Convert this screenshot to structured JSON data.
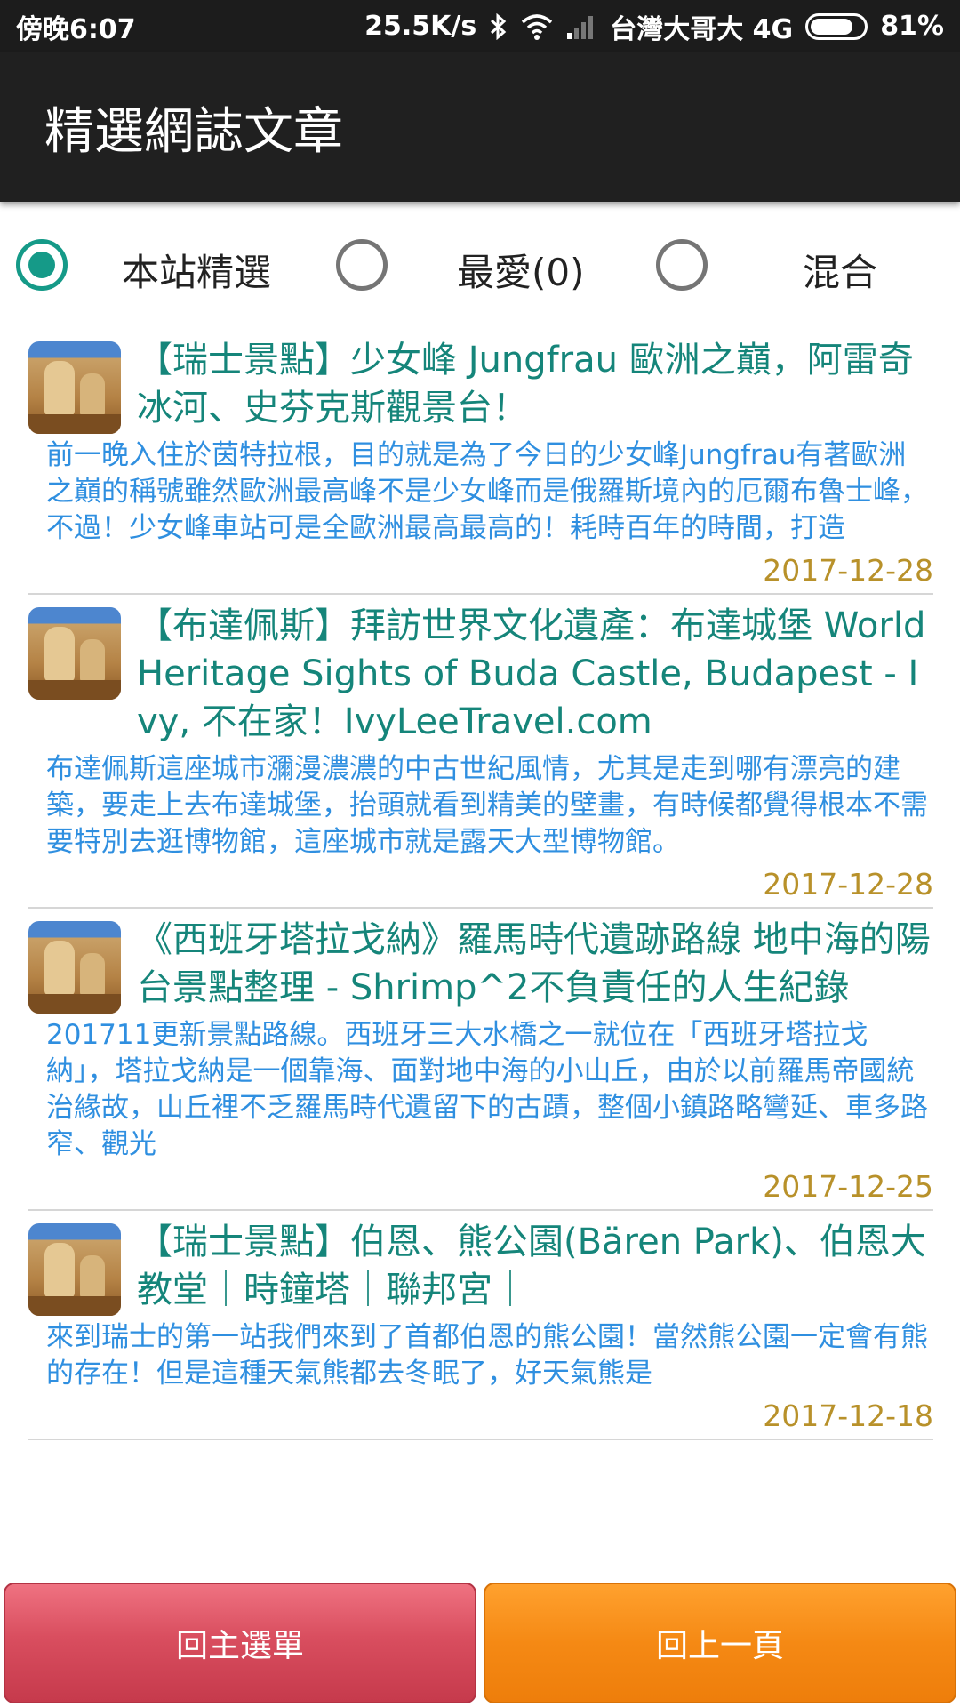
{
  "status_bar": {
    "time": "傍晚6:07",
    "speed": "25.5K/s",
    "carrier": "台灣大哥大 4G",
    "battery": "81%",
    "battery_level": 0.81
  },
  "app_bar": {
    "title": "精選網誌文章"
  },
  "filter": {
    "options": [
      {
        "label": "本站精選",
        "checked": true
      },
      {
        "label": "最愛(0)",
        "checked": false
      },
      {
        "label": "混合",
        "checked": false
      }
    ]
  },
  "articles": [
    {
      "title": "【瑞士景點】少女峰 Jungfrau 歐洲之巔，阿雷奇冰河、史芬克斯觀景台！",
      "excerpt": "前一晚入住於茵特拉根，目的就是為了今日的少女峰Jungfrau有著歐洲之巔的稱號雖然歐洲最高峰不是少女峰而是俄羅斯境內的厄爾布魯士峰，不過！少女峰車站可是全歐洲最高最高的！耗時百年的時間，打造",
      "date": "2017-12-28"
    },
    {
      "title": "【布達佩斯】拜訪世界文化遺產：布達城堡 World Heritage Sights of Buda Castle, Budapest - Ivy, 不在家！IvyLeeTravel.com",
      "excerpt": "布達佩斯這座城市瀰漫濃濃的中古世紀風情，尤其是走到哪有漂亮的建築，要走上去布達城堡，抬頭就看到精美的壁畫，有時候都覺得根本不需要特別去逛博物館，這座城市就是露天大型博物館。",
      "date": "2017-12-28"
    },
    {
      "title": "《西班牙塔拉戈納》羅馬時代遺跡路線 地中海的陽台景點整理 - Shrimp^2不負責任的人生紀錄",
      "excerpt": "201711更新景點路線。西班牙三大水橋之一就位在「西班牙塔拉戈納」，塔拉戈納是一個靠海、面對地中海的小山丘，由於以前羅馬帝國統治緣故，山丘裡不乏羅馬時代遺留下的古蹟，整個小鎮路略彎延、車多路窄、觀光",
      "date": "2017-12-25"
    },
    {
      "title": "【瑞士景點】伯恩、熊公園(Bären Park)、伯恩大教堂｜時鐘塔｜聯邦宮｜",
      "excerpt": "來到瑞士的第一站我們來到了首都伯恩的熊公園！當然熊公園一定會有熊的存在！但是這種天氣熊都去冬眠了，好天氣熊是",
      "date": "2017-12-18"
    }
  ],
  "buttons": {
    "main_menu": "回主選單",
    "back": "回上一頁"
  }
}
